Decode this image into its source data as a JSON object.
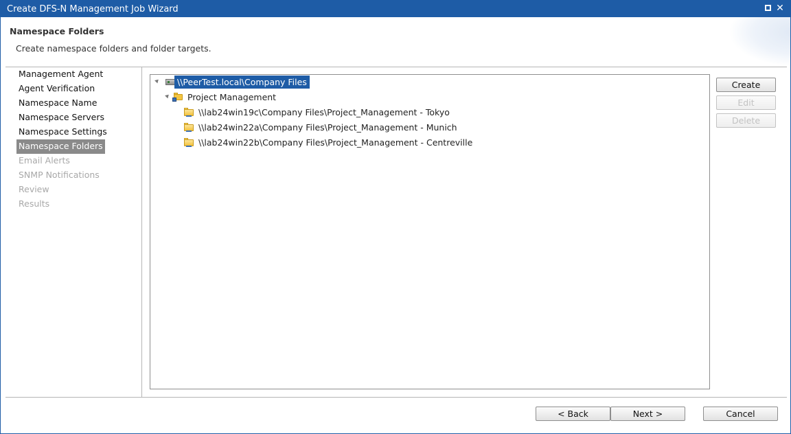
{
  "window": {
    "title": "Create DFS-N Management Job Wizard"
  },
  "header": {
    "title": "Namespace Folders",
    "subtitle": "Create namespace folders and folder targets."
  },
  "nav": {
    "items": [
      {
        "label": "Management Agent",
        "state": "normal"
      },
      {
        "label": "Agent Verification",
        "state": "normal"
      },
      {
        "label": "Namespace Name",
        "state": "normal"
      },
      {
        "label": "Namespace Servers",
        "state": "normal"
      },
      {
        "label": "Namespace Settings",
        "state": "normal"
      },
      {
        "label": "Namespace Folders",
        "state": "active"
      },
      {
        "label": "Email Alerts",
        "state": "disabled"
      },
      {
        "label": "SNMP Notifications",
        "state": "disabled"
      },
      {
        "label": "Review",
        "state": "disabled"
      },
      {
        "label": "Results",
        "state": "disabled"
      }
    ]
  },
  "tree": {
    "root": {
      "label": "\\\\PeerTest.local\\Company Files",
      "icon": "server-icon"
    },
    "folder": {
      "label": "Project Management",
      "icon": "namespace-folder-icon"
    },
    "targets": [
      {
        "label": "\\\\lab24win19c\\Company Files\\Project_Management - Tokyo",
        "icon": "shared-folder-icon"
      },
      {
        "label": "\\\\lab24win22a\\Company Files\\Project_Management - Munich",
        "icon": "shared-folder-icon"
      },
      {
        "label": "\\\\lab24win22b\\Company Files\\Project_Management - Centreville",
        "icon": "shared-folder-icon"
      }
    ]
  },
  "side_buttons": {
    "create": "Create",
    "edit": "Edit",
    "delete": "Delete"
  },
  "footer": {
    "back": "< Back",
    "next": "Next >",
    "cancel": "Cancel"
  },
  "colors": {
    "titlebar": "#1e5ca6",
    "selection": "#1e5ca6",
    "nav_active": "#8a8a8a",
    "disabled_text": "#a8a8a8"
  }
}
